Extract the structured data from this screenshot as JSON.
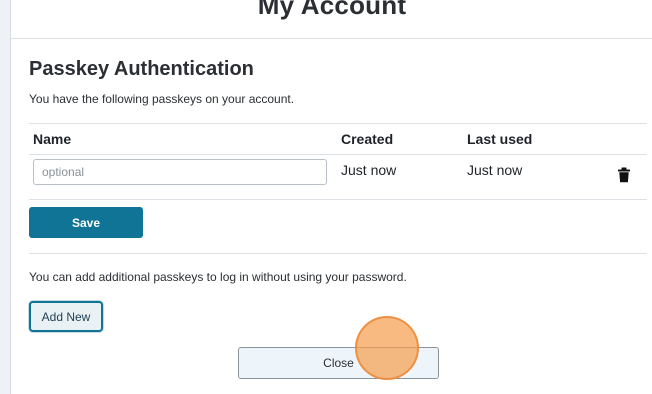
{
  "page": {
    "title": "My Account"
  },
  "passkeys": {
    "heading": "Passkey Authentication",
    "description": "You have the following passkeys on your account.",
    "columns": {
      "name": "Name",
      "created": "Created",
      "last_used": "Last used"
    },
    "rows": [
      {
        "name_value": "",
        "name_placeholder": "optional",
        "created": "Just now",
        "last_used": "Just now",
        "delete_icon": "trash-icon"
      }
    ],
    "save_label": "Save",
    "add_description": "You can add additional passkeys to log in without using your password.",
    "add_new_label": "Add New"
  },
  "footer": {
    "close_label": "Close"
  },
  "colors": {
    "accent": "#0f7496",
    "click_marker": "#f5a050"
  }
}
